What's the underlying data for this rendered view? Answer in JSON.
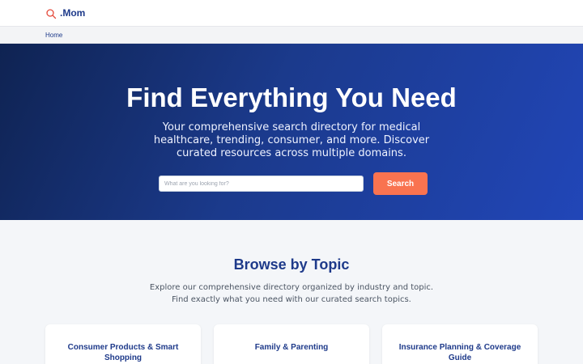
{
  "header": {
    "logo_text": ".Mom",
    "logo_icon": "search-icon",
    "accent_color": "#e54b3c"
  },
  "breadcrumb": {
    "home_label": "Home"
  },
  "hero": {
    "title": "Find Everything You Need",
    "subtitle": "Your comprehensive search directory for medical healthcare, trending, consumer, and more. Discover curated resources across multiple domains.",
    "search_placeholder": "What are you looking for?",
    "search_button_label": "Search",
    "button_color": "#f97350"
  },
  "topics": {
    "title": "Browse by Topic",
    "description": "Explore our comprehensive directory organized by industry and topic. Find exactly what you need with our curated search topics.",
    "cards": [
      {
        "title": "Consumer Products & Smart Shopping"
      },
      {
        "title": "Family & Parenting"
      },
      {
        "title": "Insurance Planning & Coverage Guide"
      }
    ]
  }
}
